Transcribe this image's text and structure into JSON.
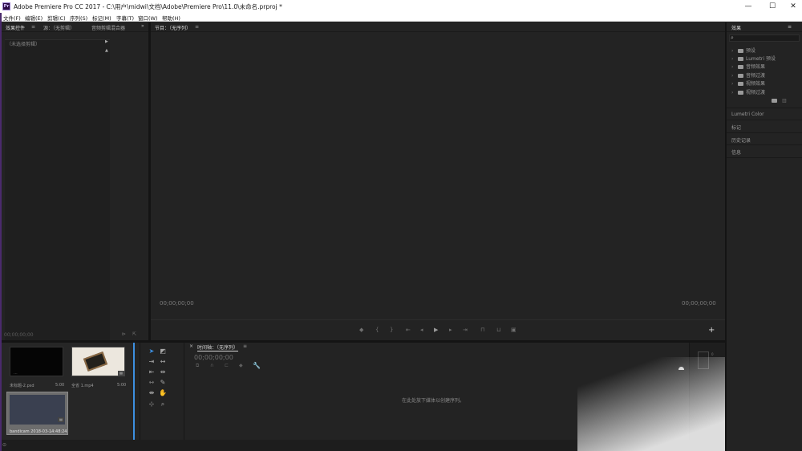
{
  "window": {
    "title": "Adobe Premiere Pro CC 2017 - C:\\用户\\midwi\\文档\\Adobe\\Premiere Pro\\11.0\\未命名.prproj *",
    "logo_text": "Pr",
    "minimize": "—",
    "maximize": "☐",
    "close": "✕"
  },
  "menu": [
    "文件(F)",
    "编辑(E)",
    "剪辑(C)",
    "序列(S)",
    "标记(M)",
    "字幕(T)",
    "窗口(W)",
    "帮助(H)"
  ],
  "source_panel": {
    "tabs": [
      "效果控件",
      "源：（无剪辑）",
      "音频剪辑混合器"
    ],
    "menu_glyph": "≡",
    "expand_glyph": "»",
    "no_clip": "（未选择剪辑）",
    "timecode": "00;00;00;00"
  },
  "program_panel": {
    "title": "节目：（无序列）",
    "menu_glyph": "≡",
    "timecode_left": "00;00;00;00",
    "timecode_right": "00;00;00;00",
    "add_glyph": "+"
  },
  "effects_panel": {
    "title": "效果",
    "menu_glyph": "≡",
    "search_glyph": "⌕",
    "items": [
      "预设",
      "Lumetri 预设",
      "音频效果",
      "音频过渡",
      "视频效果",
      "视频过渡"
    ],
    "sections": [
      "Lumetri Color",
      "标记",
      "历史记录",
      "信息"
    ]
  },
  "project_panel": {
    "items": [
      {
        "name": "未标题-2.psd",
        "duration": "5:00"
      },
      {
        "name": "全省 1.mp4",
        "duration": "5:00"
      },
      {
        "name": "bandicam 2018-03-...",
        "duration": "14:48:24"
      }
    ]
  },
  "timeline_panel": {
    "title": "时间轴：（无序列）",
    "menu_glyph": "≡",
    "close_glyph": "×",
    "timecode": "00;00;00;00",
    "drop_hint": "在此处放下媒体以创建序列。",
    "meter_label": "0"
  },
  "colors": {
    "panel_bg": "#232323",
    "title_bar": "#ffffff",
    "accent_blue": "#3d8fe0",
    "app_border": "#4b2a6d"
  }
}
